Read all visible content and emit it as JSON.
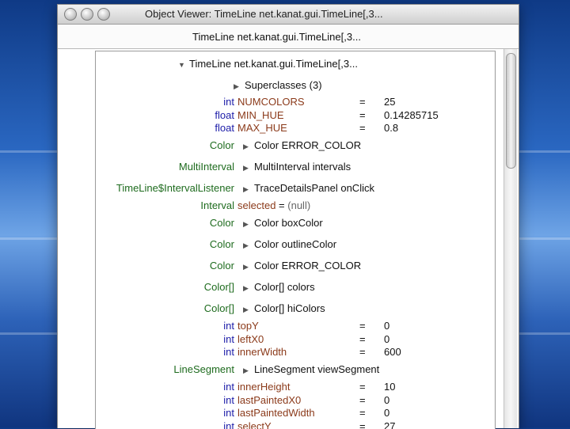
{
  "window": {
    "title": "Object Viewer: TimeLine net.kanat.gui.TimeLine[,3...",
    "header": "TimeLine net.kanat.gui.TimeLine[,3..."
  },
  "tree": {
    "root": "TimeLine net.kanat.gui.TimeLine[,3...",
    "superclasses": "Superclasses (3)",
    "eq": "=",
    "fields": {
      "numcolors": {
        "type": "int",
        "name": "NUMCOLORS",
        "value": "25"
      },
      "min_hue": {
        "type": "float",
        "name": "MIN_HUE",
        "value": "0.14285715"
      },
      "max_hue": {
        "type": "float",
        "name": "MAX_HUE",
        "value": "0.8"
      },
      "error_color1": {
        "type": "Color",
        "label": "Color ERROR_COLOR"
      },
      "intervals": {
        "type": "MultiInterval",
        "label": "MultiInterval intervals"
      },
      "onclick": {
        "type": "TimeLine$IntervalListener",
        "label": "TraceDetailsPanel onClick"
      },
      "selected": {
        "type": "Interval",
        "name": "selected",
        "eq": "=",
        "value": "(null)"
      },
      "boxcolor": {
        "type": "Color",
        "label": "Color boxColor"
      },
      "outlinecolor": {
        "type": "Color",
        "label": "Color outlineColor"
      },
      "error_color2": {
        "type": "Color",
        "label": "Color ERROR_COLOR"
      },
      "colors": {
        "type": "Color[]",
        "label": "Color[] colors"
      },
      "hicolors": {
        "type": "Color[]",
        "label": "Color[] hiColors"
      },
      "topy": {
        "type": "int",
        "name": "topY",
        "value": "0"
      },
      "leftx0": {
        "type": "int",
        "name": "leftX0",
        "value": "0"
      },
      "innerwidth": {
        "type": "int",
        "name": "innerWidth",
        "value": "600"
      },
      "viewsegment": {
        "type": "LineSegment",
        "label": "LineSegment viewSegment"
      },
      "innerheight": {
        "type": "int",
        "name": "innerHeight",
        "value": "10"
      },
      "lastpaintedx0": {
        "type": "int",
        "name": "lastPaintedX0",
        "value": "0"
      },
      "lastpaintedwidth": {
        "type": "int",
        "name": "lastPaintedWidth",
        "value": "0"
      },
      "selecty": {
        "type": "int",
        "name": "selectY",
        "value": "27"
      }
    }
  },
  "icons": {
    "collapse": "triangle-down-icon",
    "expand": "triangle-right-icon"
  }
}
